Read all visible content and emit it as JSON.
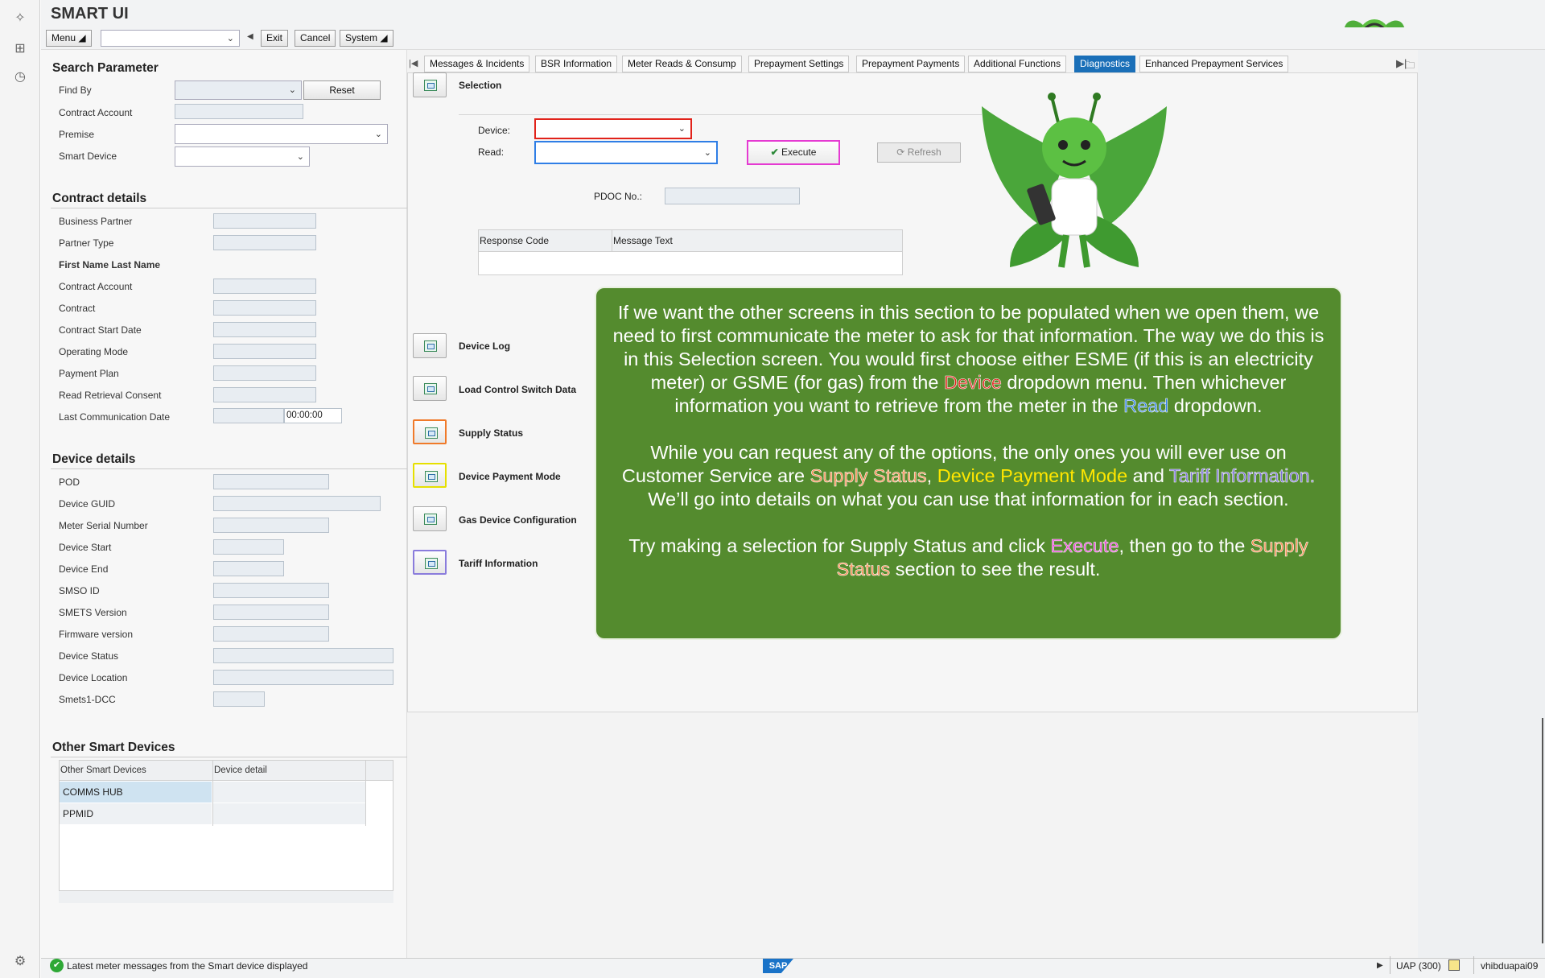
{
  "app": {
    "title": "SMART UI"
  },
  "toolbar": {
    "menu": "Menu",
    "exit": "Exit",
    "cancel": "Cancel",
    "system": "System"
  },
  "search": {
    "heading": "Search Parameter",
    "find_by": "Find By",
    "reset": "Reset",
    "contract_account": "Contract Account",
    "premise": "Premise",
    "smart_device": "Smart Device"
  },
  "contract": {
    "heading": "Contract details",
    "business_partner": "Business Partner",
    "partner_type": "Partner Type",
    "name": "First Name Last Name",
    "contract_account": "Contract Account",
    "contract": "Contract",
    "start_date": "Contract Start Date",
    "operating_mode": "Operating Mode",
    "payment_plan": "Payment Plan",
    "read_retrieval": "Read Retrieval Consent",
    "last_comm": "Last Communication Date",
    "last_comm_time": "00:00:00"
  },
  "device": {
    "heading": "Device details",
    "pod": "POD",
    "guid": "Device GUID",
    "serial": "Meter Serial Number",
    "start": "Device Start",
    "end": "Device End",
    "smso": "SMSO ID",
    "smets": "SMETS Version",
    "firmware": "Firmware version",
    "status": "Device Status",
    "location": "Device Location",
    "smets1": "Smets1-DCC"
  },
  "others": {
    "heading": "Other Smart Devices",
    "col1": "Other Smart Devices",
    "col2": "Device detail",
    "rows": [
      "COMMS HUB",
      "PPMID"
    ]
  },
  "tabs": [
    "Messages & Incidents",
    "BSR Information",
    "Meter Reads & Consump",
    "Prepayment Settings",
    "Prepayment Payments",
    "Additional Functions",
    "Diagnostics",
    "Enhanced Prepayment Services"
  ],
  "selection": {
    "heading": "Selection",
    "device_label": "Device:",
    "read_label": "Read:",
    "execute": "Execute",
    "refresh": "Refresh",
    "pdoc_label": "PDOC No.:",
    "col_response": "Response Code",
    "col_message": "Message Text"
  },
  "side_buttons": [
    "Device Log",
    "Load Control Switch Data",
    "Supply Status",
    "Device Payment Mode",
    "Gas Device Configuration",
    "Tariff Information"
  ],
  "callout": {
    "p1a": "If we want the other screens in this section to be populated when we open them, we need to first communicate the meter to ask for that information. The way we do this is in this Selection screen. You would first choose either ESME (if this is an electricity meter) or GSME (for gas) from the ",
    "p1_device": "Device",
    "p1b": " dropdown menu. Then whichever information you want to retrieve from the meter in the ",
    "p1_read": "Read",
    "p1c": " dropdown.",
    "p2a": "While you can request any of the options, the only ones you will ever use on Customer Service are ",
    "p2_supply": "Supply Status",
    "p2_sep": ", ",
    "p2_payment": "Device Payment Mode",
    "p2_and": "  and ",
    "p2_tariff": "Tariff Information.",
    "p2b": " We’ll go into details on what you can use that information for in each section.",
    "p3a": "Try making a selection for Supply Status and click ",
    "p3_execute": "Execute",
    "p3b": ", then go to the ",
    "p3_supply": "Supply Status",
    "p3c": " section to see the result."
  },
  "status": {
    "message": "Latest meter messages from the Smart device displayed",
    "logo": "SAP",
    "system": "UAP (300)",
    "user": "vhibduapai09"
  },
  "colors": {
    "accent": "#1a6fb8",
    "callout_bg": "#548b2e",
    "device_border": "#e1221a",
    "read_border": "#2f7ee6",
    "execute_border": "#e53ad2"
  }
}
